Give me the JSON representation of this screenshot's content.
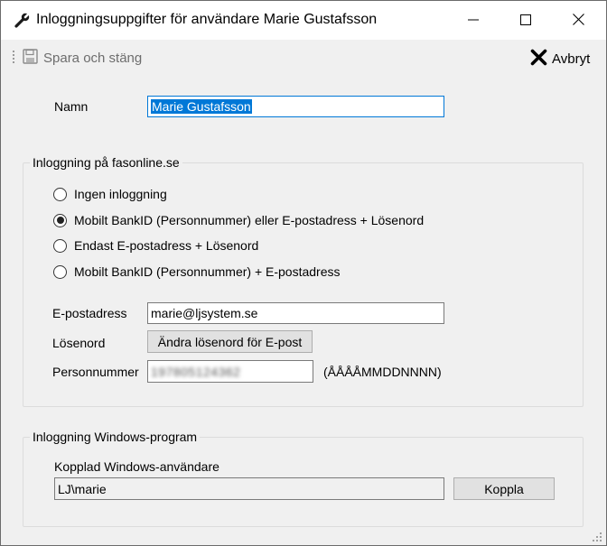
{
  "window": {
    "title": "Inloggningsuppgifter för användare Marie Gustafsson",
    "icon": "wrench-icon"
  },
  "toolbar": {
    "save_label": "Spara och stäng",
    "save_icon": "floppy-disk-icon",
    "cancel_label": "Avbryt",
    "cancel_icon": "close-x-icon"
  },
  "name": {
    "label": "Namn",
    "value": "Marie Gustafsson"
  },
  "web_login": {
    "group_title": "Inloggning på fasonline.se",
    "options": [
      {
        "label": "Ingen inloggning",
        "selected": false
      },
      {
        "label": "Mobilt BankID (Personnummer) eller E-postadress + Lösenord",
        "selected": true
      },
      {
        "label": "Endast E-postadress + Lösenord",
        "selected": false
      },
      {
        "label": "Mobilt BankID (Personnummer) + E-postadress",
        "selected": false
      }
    ],
    "email_label": "E-postadress",
    "email_value": "marie@ljsystem.se",
    "password_label": "Lösenord",
    "password_button": "Ändra lösenord för E-post",
    "personnummer_label": "Personnummer",
    "personnummer_value": "197805124362",
    "personnummer_format": "(ÅÅÅÅMMDDNNNN)"
  },
  "windows_login": {
    "group_title": "Inloggning Windows-program",
    "linked_user_label": "Kopplad Windows-användare",
    "linked_user_value": "LJ\\marie",
    "connect_button": "Koppla"
  },
  "colors": {
    "selection": "#0078d7",
    "window_bg": "#f0f0f0",
    "button_bg": "#e1e1e1"
  }
}
